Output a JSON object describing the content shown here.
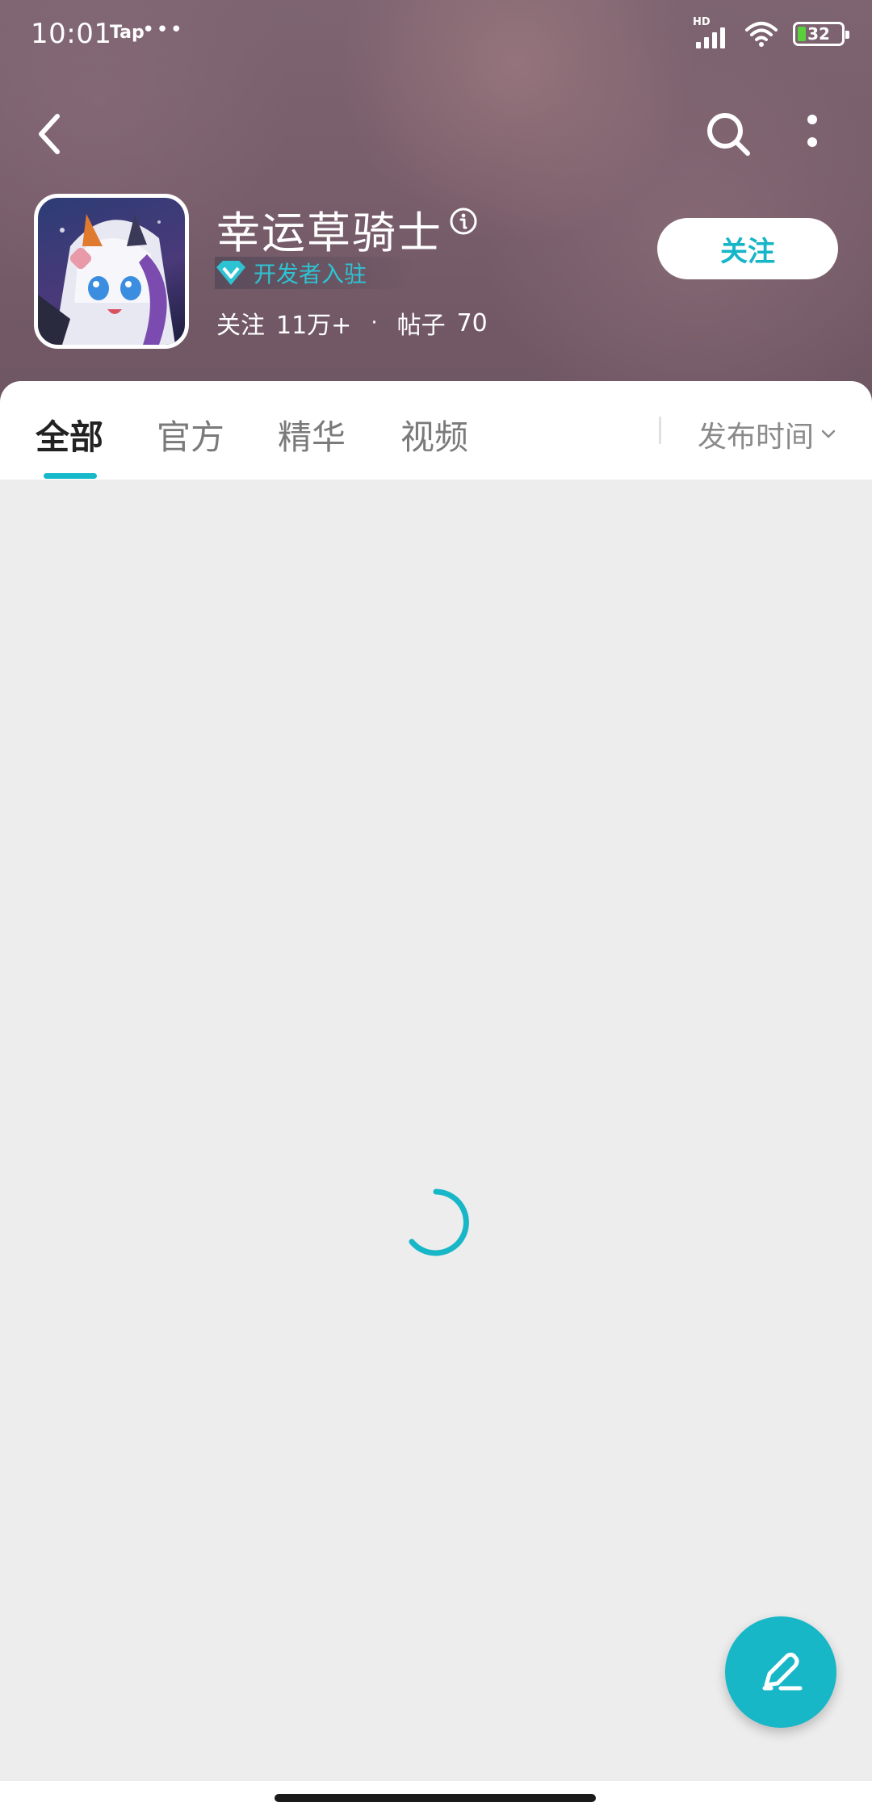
{
  "status_bar": {
    "time": "10:01",
    "app": "Tap",
    "dots": "•••",
    "network": "HD",
    "battery": "32"
  },
  "header": {
    "game_title": "幸运草骑士",
    "developer_badge": "开发者入驻",
    "followers_label": "关注",
    "followers_count": "11万+",
    "separator": "·",
    "posts_label": "帖子",
    "posts_count": "70",
    "follow_button": "关注"
  },
  "tabs": [
    {
      "label": "全部",
      "active": true
    },
    {
      "label": "官方",
      "active": false
    },
    {
      "label": "精华",
      "active": false
    },
    {
      "label": "视频",
      "active": false
    }
  ],
  "sort": {
    "label": "发布时间"
  },
  "icons": {
    "back": "back-arrow-icon",
    "search": "search-icon",
    "more": "more-vertical-icon",
    "info": "info-icon",
    "gem": "diamond-icon",
    "sort": "chevron-down-icon",
    "spinner": "loading-spinner-icon",
    "compose": "pen-icon"
  },
  "colors": {
    "accent": "#16b5c8",
    "badge_text": "#2ec3d3",
    "battery_fill": "#5ad03a"
  }
}
